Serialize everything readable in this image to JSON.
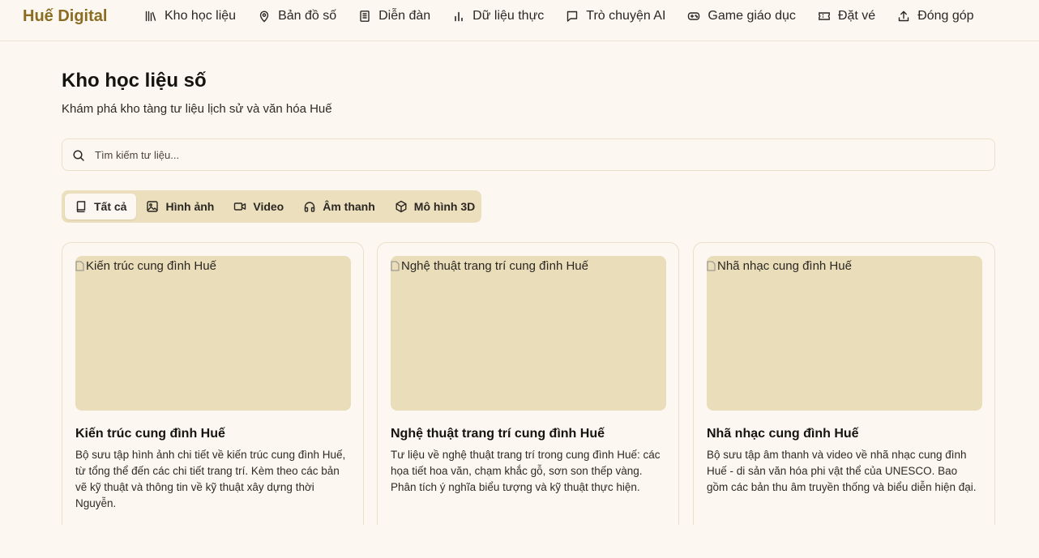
{
  "brand": "Huế Digital",
  "nav": [
    {
      "label": "Kho học liệu",
      "icon": "library-icon"
    },
    {
      "label": "Bản đồ số",
      "icon": "map-pin-icon"
    },
    {
      "label": "Diễn đàn",
      "icon": "book-icon"
    },
    {
      "label": "Dữ liệu thực",
      "icon": "bar-chart-icon"
    },
    {
      "label": "Trò chuyện AI",
      "icon": "chat-icon"
    },
    {
      "label": "Game giáo dục",
      "icon": "gamepad-icon"
    },
    {
      "label": "Đặt vé",
      "icon": "ticket-icon"
    },
    {
      "label": "Đóng góp",
      "icon": "upload-icon"
    }
  ],
  "page": {
    "title": "Kho học liệu số",
    "subtitle": "Khám phá kho tàng tư liệu lịch sử và văn hóa Huế"
  },
  "search": {
    "placeholder": "Tìm kiếm tư liệu...",
    "value": ""
  },
  "tabs": [
    {
      "label": "Tất cả",
      "icon": "book-icon",
      "active": true
    },
    {
      "label": "Hình ảnh",
      "icon": "image-icon",
      "active": false
    },
    {
      "label": "Video",
      "icon": "video-icon",
      "active": false
    },
    {
      "label": "Âm thanh",
      "icon": "headphones-icon",
      "active": false
    },
    {
      "label": "Mô hình 3D",
      "icon": "cube-icon",
      "active": false
    }
  ],
  "cards": [
    {
      "image_alt": "Kiến trúc cung đình Huế",
      "title": "Kiến trúc cung đình Huế",
      "description": "Bộ sưu tập hình ảnh chi tiết về kiến trúc cung đình Huế, từ tổng thể đến các chi tiết trang trí. Kèm theo các bản vẽ kỹ thuật và thông tin về kỹ thuật xây dựng thời Nguyễn."
    },
    {
      "image_alt": "Nghệ thuật trang trí cung đình Huế",
      "title": "Nghệ thuật trang trí cung đình Huế",
      "description": "Tư liệu về nghệ thuật trang trí trong cung đình Huế: các họa tiết hoa văn, chạm khắc gỗ, sơn son thếp vàng. Phân tích ý nghĩa biểu tượng và kỹ thuật thực hiện."
    },
    {
      "image_alt": "Nhã nhạc cung đình Huế",
      "title": "Nhã nhạc cung đình Huế",
      "description": "Bộ sưu tập âm thanh và video về nhã nhạc cung đình Huế - di sản văn hóa phi vật thể của UNESCO. Bao gồm các bản thu âm truyền thống và biểu diễn hiện đại."
    }
  ],
  "colors": {
    "brand": "#8a6d22",
    "background": "#fcf8f1",
    "tab_bar": "#ecdfbd",
    "image_placeholder": "#eaddba",
    "border": "#eadfca"
  }
}
